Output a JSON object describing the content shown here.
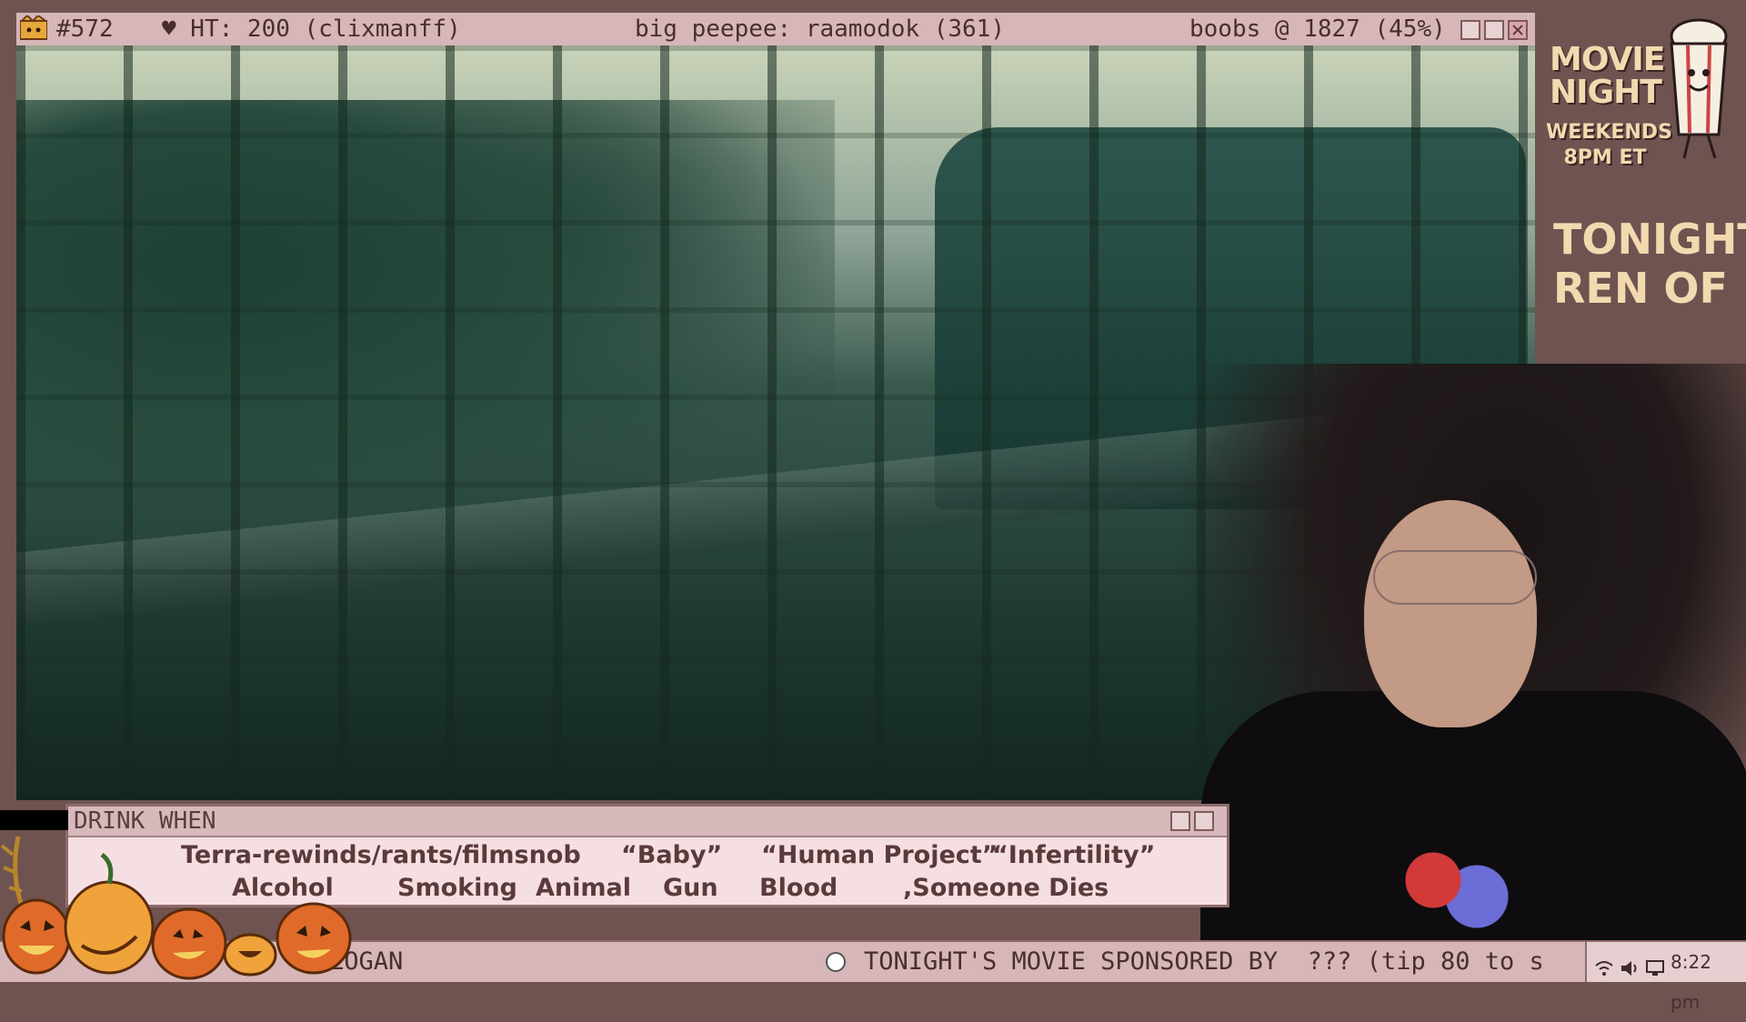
{
  "top_bar": {
    "counter": "#572",
    "hype": "♥ HT: 200 (clixmanff)",
    "peepee": "big peepee: raamodok (361)",
    "boobs": "boobs @ 1827 (45%)"
  },
  "window_controls": [
    "minimize",
    "maximize",
    "close"
  ],
  "side": {
    "movie_night": "MOVIE NIGHT",
    "schedule": "WEEKENDS 8PM ET",
    "tonight_line1": "TONIGHT:",
    "tonight_line2": "REN OF M"
  },
  "drink_when": {
    "title": "DRINK WHEN",
    "row1": [
      "Terra-rewinds/rants/filmsnob",
      "“Baby”",
      "“Human Project”",
      "“Infertility”"
    ],
    "row2": [
      "Alcohol",
      "Smoking",
      "Animal",
      "Gun",
      "Blood",
      ",Someone Dies"
    ]
  },
  "taskbar": {
    "left_text": "LOGAN",
    "ticker": "TONIGHT'S MOVIE SPONSORED BY  ??? (tip 80 to s",
    "clock": "8:22 pm"
  },
  "colors": {
    "bar": "#d6b6b8",
    "panel": "#f6dfe3",
    "background": "#6e5350",
    "accent_text": "#f2d9b0"
  },
  "icons": [
    "crown-icon",
    "heart-icon",
    "popcorn-mascot-icon",
    "pumpkin-icon",
    "network-icon",
    "volume-icon",
    "display-icon"
  ]
}
